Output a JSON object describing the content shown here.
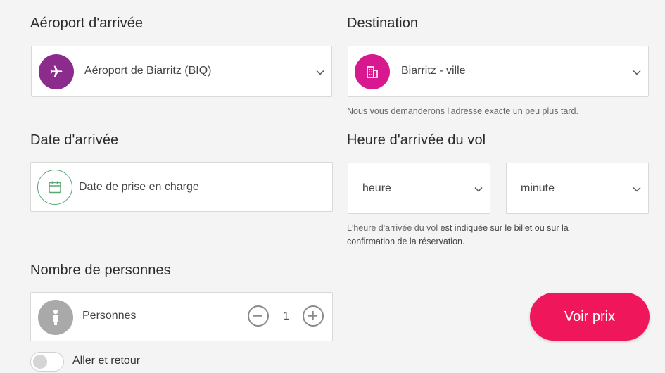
{
  "arrival_airport": {
    "label": "Aéroport d'arrivée",
    "value": "Aéroport de Biarritz (BIQ)",
    "icon": "airplane-icon",
    "icon_color": "#8b2c8d"
  },
  "destination": {
    "label": "Destination",
    "value": "Biarritz - ville",
    "icon": "building-icon",
    "icon_color": "#d8188f",
    "hint": "Nous vous demanderons l'adresse exacte un peu plus tard."
  },
  "arrival_date": {
    "label": "Date d'arrivée",
    "placeholder": "Date de prise en charge",
    "icon": "calendar-icon",
    "icon_color": "#5aa874"
  },
  "flight_time": {
    "label": "Heure d'arrivée du vol",
    "hour_placeholder": "heure",
    "minute_placeholder": "minute",
    "hint_part1": "L'heure d'arrivée du vol ",
    "hint_part2": "est indiquée sur le billet ou sur la",
    "hint_part3": "confirmation de la réservation."
  },
  "passengers": {
    "label": "Nombre de personnes",
    "field_label": "Personnes",
    "count": "1",
    "icon": "person-icon",
    "icon_color": "#a9a9a9"
  },
  "round_trip": {
    "label": "Aller et retour",
    "enabled": false
  },
  "submit": {
    "label": "Voir prix",
    "color": "#f0165c"
  }
}
